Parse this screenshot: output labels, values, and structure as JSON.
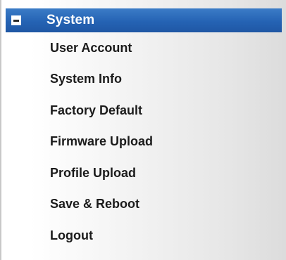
{
  "menu": {
    "header": {
      "label": "System",
      "icon": "collapse-minus-icon"
    },
    "items": [
      {
        "label": "User Account"
      },
      {
        "label": "System Info"
      },
      {
        "label": "Factory Default"
      },
      {
        "label": "Firmware Upload"
      },
      {
        "label": "Profile Upload"
      },
      {
        "label": "Save & Reboot"
      },
      {
        "label": "Logout"
      }
    ]
  },
  "colors": {
    "header_background": "#2563b4",
    "header_text": "#ffffff",
    "item_text": "#1b1b1b"
  }
}
